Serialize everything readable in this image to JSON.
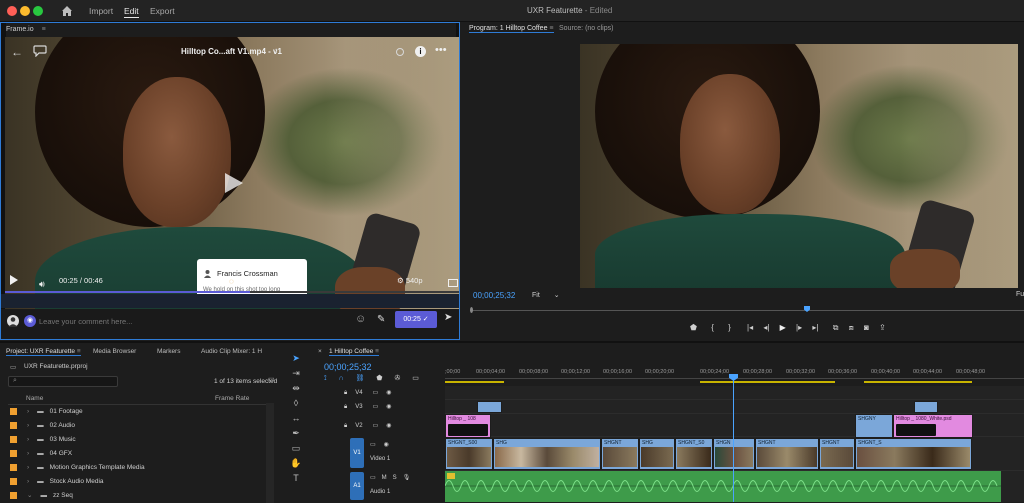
{
  "app": {
    "window_title": "UXR Featurette",
    "edited_label": " - Edited",
    "menu": [
      "Import",
      "Edit",
      "Export"
    ]
  },
  "frameio": {
    "panel_title": "Frame.io",
    "file_title": "Hilltop Co...aft V1.mp4 - v1",
    "time_current": "00:25",
    "time_total": "00:46",
    "quality": "540p",
    "comment_author": "Francis Crossman",
    "comment_text": "We hold on this shot too long",
    "comment_placeholder": "Leave your comment here...",
    "comment_timestamp": "00:25",
    "marker_color": "#22c33b",
    "accent_color": "#5b5bd6"
  },
  "program": {
    "tab_program": "Program: 1 Hilltop Coffee",
    "tab_source": "Source: (no clips)",
    "timecode": "00;00;25;32",
    "zoom": "Fit",
    "right_partial": "Fu"
  },
  "project": {
    "tabs": [
      "Project: UXR Featurette",
      "Media Browser",
      "Markers",
      "Audio Clip Mixer: 1 H"
    ],
    "file": "UXR Featurette.prproj",
    "selection_status": "1 of 13 items selected",
    "col_name": "Name",
    "col_rate": "Frame Rate",
    "items": [
      "01 Footage",
      "02 Audio",
      "03 Music",
      "04 GFX",
      "Motion Graphics Template Media",
      "Stock Audio Media",
      "zz Seq"
    ]
  },
  "timeline": {
    "sequence_name": "1 Hilltop Coffee",
    "timecode": "00;00;25;32",
    "ruler": [
      ";00;00",
      "00;00;04;00",
      "00;00;08;00",
      "00;00;12;00",
      "00;00;16;00",
      "00;00;20;00",
      "00;00;24;00",
      "00;00;28;00",
      "00;00;32;00",
      "00;00;36;00",
      "00;00;40;00",
      "00;00;44;00",
      "00;00;48;00"
    ],
    "tracks": {
      "v4": "V4",
      "v3": "V3",
      "v2": "V2",
      "v1": "V1",
      "video1": "Video 1",
      "a1": "A1",
      "audio1": "Audio 1",
      "mute": "M",
      "solo": "S"
    },
    "clips_v2": [
      "Hilltop _ 108",
      "SHGNY",
      "Hilltop _ 1080_White.psd"
    ],
    "clips_v1": [
      "SHGNT_S00",
      "SHG",
      "SHGNT",
      "SHG",
      "SHGNT_S0",
      "SHGN",
      "SHGNT",
      "SHGNT",
      "SHGNT_S"
    ]
  }
}
